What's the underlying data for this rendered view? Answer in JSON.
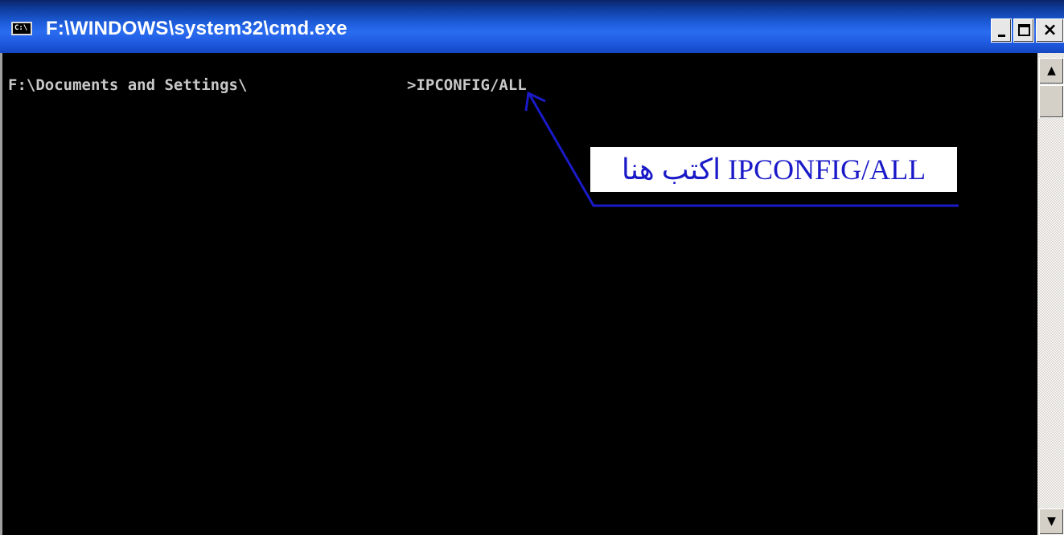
{
  "window": {
    "title": "F:\\WINDOWS\\system32\\cmd.exe",
    "icon_text": "C:\\",
    "buttons": {
      "minimize_icon": "minimize-icon",
      "maximize_icon": "maximize-icon",
      "close_label": "×"
    }
  },
  "console": {
    "prompt": "F:\\Documents and Settings\\",
    "command": ">IPCONFIG/ALL"
  },
  "annotation": {
    "text": "اكتب هنا IPCONFIG/ALL",
    "color": "#1a1ac8"
  },
  "scrollbar": {
    "up_glyph": "▲",
    "down_glyph": "▼"
  },
  "colors": {
    "titlebar": "#1c5bd8",
    "console_bg": "#000000",
    "console_text": "#c8c8c8"
  }
}
